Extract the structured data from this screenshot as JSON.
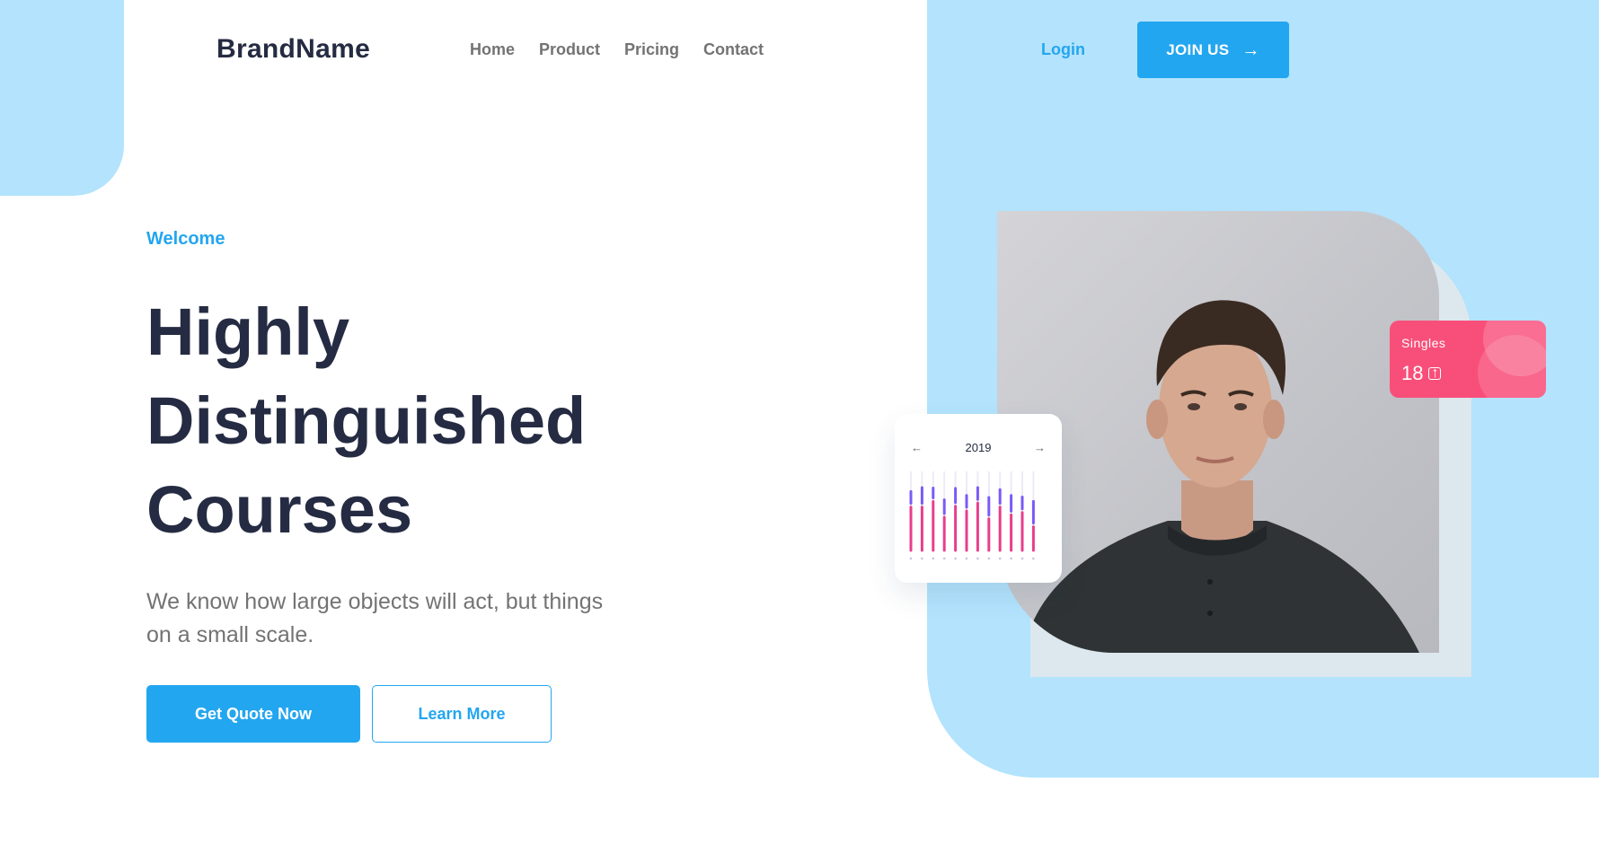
{
  "header": {
    "brand": "BrandName",
    "nav": [
      "Home",
      "Product",
      "Pricing",
      "Contact"
    ],
    "login": "Login",
    "join": "JOIN US",
    "join_icon": "arrow-right-icon"
  },
  "hero": {
    "welcome": "Welcome",
    "title_lines": [
      "Highly",
      "Distinguished",
      "Courses"
    ],
    "description": "We know how large objects will act, but things on a small scale.",
    "primary_cta": "Get Quote Now",
    "secondary_cta": "Learn More"
  },
  "chart_card": {
    "year": "2019",
    "prev_icon": "arrow-left-icon",
    "next_icon": "arrow-right-icon"
  },
  "chart_data": {
    "type": "bar",
    "title": "2019",
    "categories": [
      "",
      "",
      "",
      "",
      "",
      "",
      "",
      "",
      "",
      "",
      "",
      ""
    ],
    "series": [
      {
        "values": [
          0.55,
          0.55,
          0.62,
          0.42,
          0.56,
          0.5,
          0.6,
          0.4,
          0.55,
          0.45,
          0.48,
          0.3
        ]
      },
      {
        "values": [
          0.3,
          0.4,
          0.25,
          0.35,
          0.36,
          0.3,
          0.3,
          0.45,
          0.35,
          0.4,
          0.3,
          0.55
        ]
      }
    ]
  },
  "singles_card": {
    "label": "Singles",
    "value": "18",
    "icon": "arrow-up-icon"
  },
  "colors": {
    "primary": "#23a6f0",
    "dark_text": "#252b42",
    "muted_text": "#737373",
    "light_blue_bg": "#b3e3fd",
    "pink_card": "#f84f7a",
    "chart_pink": "#e83e8c",
    "chart_purple": "#7a5af8"
  }
}
